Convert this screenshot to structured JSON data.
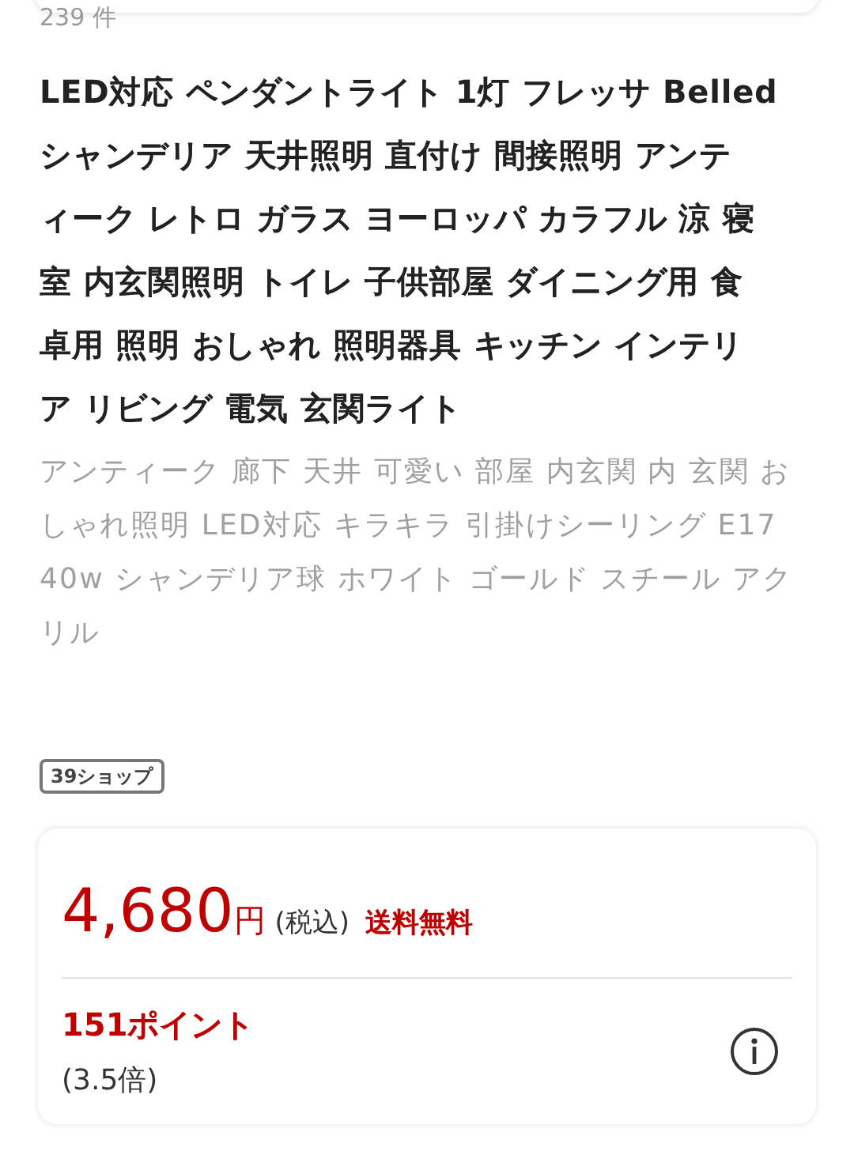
{
  "result_count": "239 件",
  "product": {
    "title_lines": [
      "LED対応 ペンダントライト 1灯 フレッサ Belled",
      "シャンデリア 天井照明 直付け 間接照明 アンテ",
      "ィーク レトロ ガラス ヨーロッパ カラフル 涼 寝",
      "室 内玄関照明 トイレ 子供部屋 ダイニング用 食",
      "卓用 照明 おしゃれ 照明器具 キッチン インテリ",
      "ア リビング 電気 玄関ライト"
    ],
    "description": "アンティーク 廊下 天井 可愛い 部屋 内玄関 内 玄関 おしゃれ照明 LED対応 キラキラ 引掛けシーリング E17 40w シャンデリア球 ホワイト ゴールド スチール アクリル",
    "badge": "39ショップ"
  },
  "price_card": {
    "price": "4,680",
    "currency": "円",
    "tax_note": "(税込)",
    "shipping": "送料無料",
    "points": "151ポイント",
    "multiplier": "(3.5倍)"
  }
}
